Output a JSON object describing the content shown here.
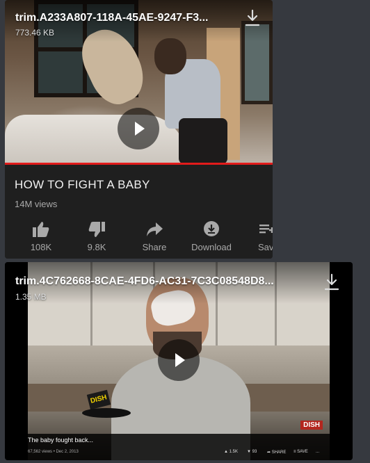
{
  "attachments": [
    {
      "file_name": "trim.A233A807-118A-45AE-9247-F3...",
      "file_size": "773.46 KB",
      "video_title": "HOW TO FIGHT A BABY",
      "views": "14M views",
      "progress_percent": 100,
      "actions": [
        {
          "label": "108K",
          "icon": "thumbs-up-icon"
        },
        {
          "label": "9.8K",
          "icon": "thumbs-down-icon"
        },
        {
          "label": "Share",
          "icon": "share-icon"
        },
        {
          "label": "Download",
          "icon": "download-icon"
        },
        {
          "label": "Sav",
          "icon": "save-icon"
        }
      ]
    },
    {
      "file_name": "trim.4C762668-8CAE-4FD6-AC31-7C3C08548D8...",
      "file_size": "1.35 MB",
      "caption": "The baby fought back...",
      "meta": "67,562 views • Dec 2, 2013",
      "badge_text": "DISH",
      "logo_text": "DISH",
      "mini_actions": [
        {
          "label": "1.5K",
          "icon": "thumbs-up-icon"
        },
        {
          "label": "93",
          "icon": "thumbs-down-icon"
        },
        {
          "label": "SHARE",
          "icon": "share-icon"
        },
        {
          "label": "SAVE",
          "icon": "save-icon"
        },
        {
          "label": "...",
          "icon": "more-icon"
        }
      ]
    }
  ],
  "colors": {
    "background": "#36393f",
    "progress": "#e21b1b",
    "info_panel": "#1f1f1f"
  }
}
